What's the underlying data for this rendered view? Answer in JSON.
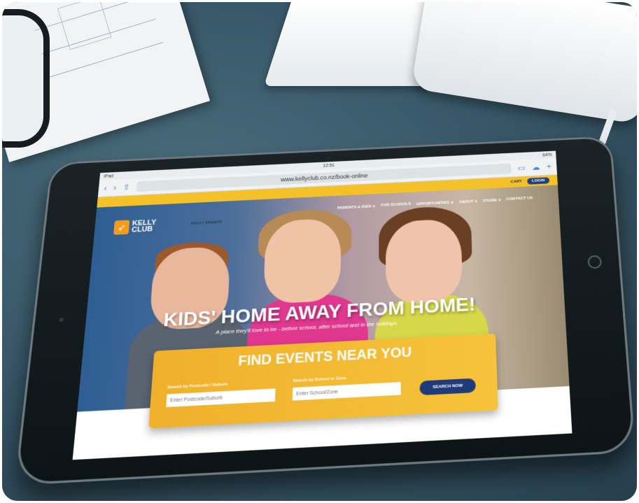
{
  "device": {
    "status_carrier": "iPad",
    "status_time": "12:51",
    "status_battery": "64%"
  },
  "browser": {
    "url": "www.kellyclub.co.nz/book-online",
    "icons": [
      "back-icon",
      "forward-icon",
      "share-icon",
      "bookmarks-icon",
      "cloud-icon",
      "new-tab-icon"
    ]
  },
  "site": {
    "cart_label": "CART",
    "login_label": "LOGIN",
    "logo_text": "KELLY CLUB",
    "partner_logo_text": "KELLY SPORTS",
    "nav": [
      "PARENTS & KIDS ∨",
      "FOR SCHOOLS",
      "OPPORTUNITIES ∨",
      "ABOUT ∨",
      "STORE ∨",
      "CONTACT US"
    ],
    "headline": "KIDS' HOME AWAY FROM HOME!",
    "tagline": "A place they'll love to be - before school, after school and in the holidays.",
    "finder": {
      "title": "FIND EVENTS NEAR YOU",
      "postcode_label": "Search by Postcode / Suburb",
      "postcode_placeholder": "Enter Postcode/Suburb",
      "school_label": "Search by School or Zone",
      "school_placeholder": "Enter School/Zone",
      "search_button": "SEARCH NOW"
    }
  },
  "colors": {
    "brand_yellow": "#f4c228",
    "brand_navy": "#1d3e8a",
    "logo_orange": "#f39c1f"
  }
}
